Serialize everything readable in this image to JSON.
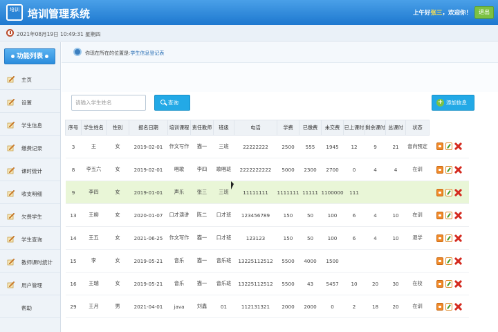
{
  "app": {
    "logo_text": "培训",
    "title": "培训管理系统"
  },
  "header": {
    "greeting_prefix": "上午好",
    "username": "张三",
    "greeting_suffix": "，欢迎你！",
    "logout_label": "退出"
  },
  "subbar": {
    "datetime": "2021年08月19日 10:49:31 星期四"
  },
  "sidebar": {
    "title": "功能列表",
    "items": [
      {
        "label": "主页"
      },
      {
        "label": "设置"
      },
      {
        "label": "学生信息"
      },
      {
        "label": "缴费记录"
      },
      {
        "label": "课时统计"
      },
      {
        "label": "收支明细"
      },
      {
        "label": "欠费学生"
      },
      {
        "label": "学生查询"
      },
      {
        "label": "教师课时统计"
      },
      {
        "label": "用户管理"
      },
      {
        "label": "帮助"
      }
    ]
  },
  "breadcrumb": {
    "prefix": "你现在所在的位置是:",
    "current": "学生信息登记表"
  },
  "toolbar": {
    "search_placeholder": "请输入学生姓名",
    "search_label": "查询",
    "add_label": "添加信息"
  },
  "table": {
    "columns": [
      "序号",
      "学生姓名",
      "性别",
      "报名日期",
      "培训课程",
      "责任教师",
      "班级",
      "电话",
      "学费",
      "已缴费",
      "未交费",
      "已上课时",
      "剩余课时",
      "总课时",
      "状态"
    ],
    "rows": [
      [
        "3",
        "王",
        "女",
        "2019-02-01",
        "作文写作",
        "猫一",
        "三班",
        "22222222",
        "2500",
        "555",
        "1945",
        "12",
        "9",
        "21",
        "音向预定"
      ],
      [
        "8",
        "李五六",
        "女",
        "2019-02-01",
        "唱歌",
        "李四",
        "歌唱班",
        "2222222222",
        "5000",
        "2300",
        "2700",
        "0",
        "4",
        "4",
        "在训"
      ],
      [
        "9",
        "李四",
        "女",
        "2019-01-01",
        "声乐",
        "张三",
        "三班",
        "11111111",
        "1111111",
        "11111",
        "1100000",
        "111",
        "",
        "",
        ""
      ],
      [
        "13",
        "王柳",
        "女",
        "2020-01-07",
        "口才演讲",
        "陈二",
        "口才班",
        "123456789",
        "150",
        "50",
        "100",
        "6",
        "4",
        "10",
        "在训"
      ],
      [
        "14",
        "王五",
        "女",
        "2021-06-25",
        "作文写作",
        "猫一",
        "口才班",
        "123123",
        "150",
        "50",
        "100",
        "6",
        "4",
        "10",
        "退学"
      ],
      [
        "15",
        "李",
        "女",
        "2019-05-21",
        "音乐",
        "猫一",
        "音乐班",
        "13225112512",
        "5500",
        "4000",
        "1500",
        "",
        "",
        "",
        ""
      ],
      [
        "16",
        "王瑞",
        "女",
        "2019-05-21",
        "音乐",
        "猫一",
        "音乐班",
        "13225112512",
        "5500",
        "43",
        "5457",
        "10",
        "20",
        "30",
        "在校"
      ],
      [
        "29",
        "王月",
        "男",
        "2021-04-01",
        "java",
        "刘鑫",
        "01",
        "112131321",
        "2000",
        "2000",
        "0",
        "2",
        "18",
        "20",
        "在训"
      ]
    ],
    "highlighted_row": 2
  }
}
